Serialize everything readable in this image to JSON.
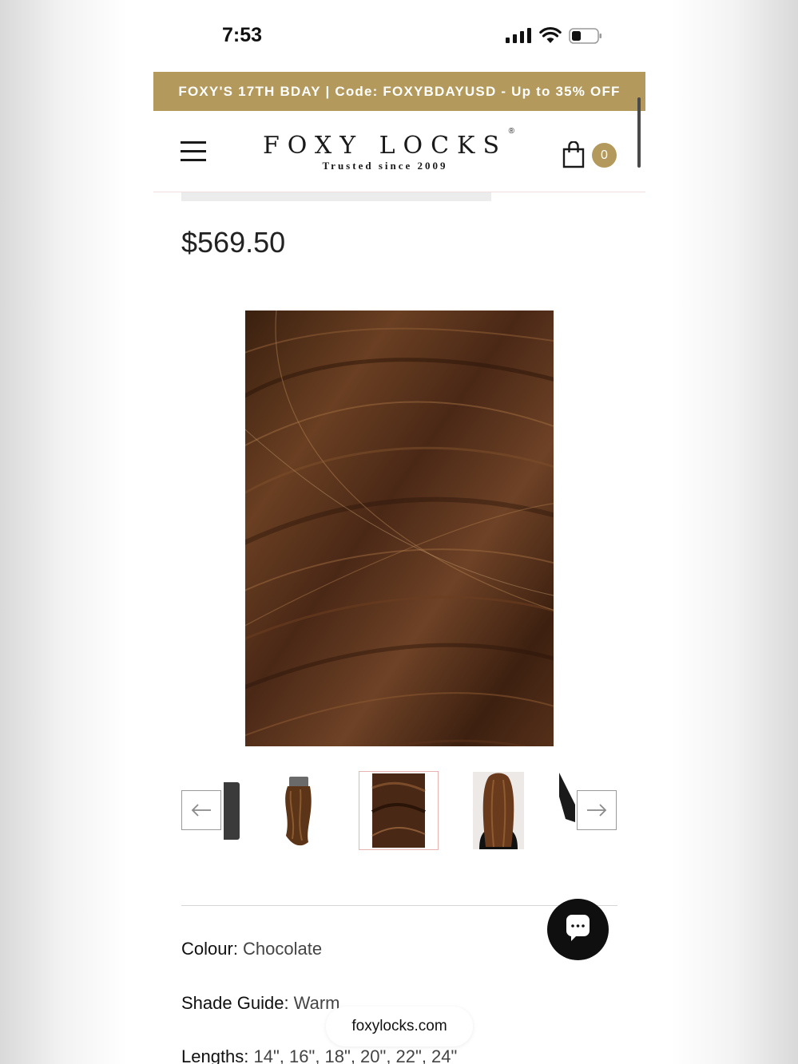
{
  "status_bar": {
    "time": "7:53"
  },
  "promo": {
    "text": "FOXY'S 17TH BDAY | Code: FOXYBDAYUSD - Up to 35% OFF"
  },
  "header": {
    "brand": "FOXY LOCKS",
    "registered_mark": "®",
    "tagline": "Trusted since 2009",
    "cart_count": "0"
  },
  "product": {
    "price": "$569.50",
    "attributes": [
      {
        "label": "Colour",
        "value": "Chocolate"
      },
      {
        "label": "Shade Guide",
        "value": "Warm"
      },
      {
        "label": "Lengths",
        "value": "14\", 16\", 18\", 20\", 22\", 24\""
      }
    ],
    "separator": ": "
  },
  "gallery": {
    "thumbnails": [
      "clip-in-wefts",
      "hair-swatch",
      "model-back-view"
    ],
    "selected_index": 1
  },
  "browser": {
    "url": "foxylocks.com"
  },
  "colors": {
    "accent": "#b39a5c",
    "hair": "#4a2a18"
  }
}
